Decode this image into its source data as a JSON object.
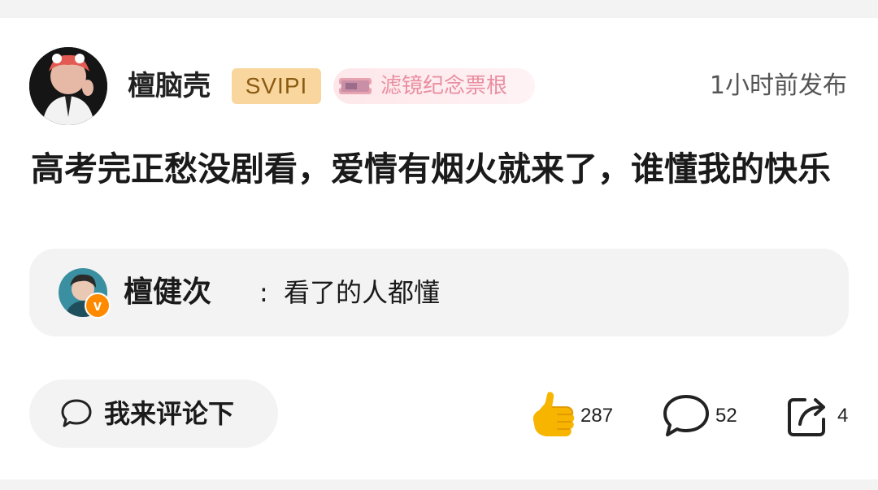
{
  "post": {
    "author": "檀脑壳",
    "vip_badge": "SVIPI",
    "stub_badge": "滤镜纪念票根",
    "time": "1小时前发布",
    "text": "高考完正愁没剧看，爱情有烟火就来了，谁懂我的快乐"
  },
  "top_comment": {
    "author": "檀健次",
    "separator": ":",
    "text": "看了的人都懂"
  },
  "actions": {
    "comment_button_label": "我来评论下",
    "like_count": "287",
    "comment_count": "52",
    "share_count": "4"
  },
  "icons": {
    "like": "thumbs-up-icon",
    "comment": "speech-bubble-icon",
    "share": "share-icon"
  },
  "colors": {
    "vip_badge_bg": "#f8d69e",
    "vip_badge_text": "#8a5a12",
    "stub_text": "#e98ea0",
    "like_icon": "#f7b500",
    "verified_badge": "#ff8a00"
  }
}
